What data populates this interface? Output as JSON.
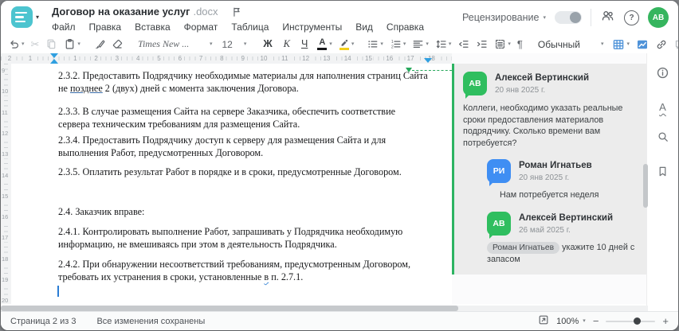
{
  "window": {
    "title": "Договор на оказание услуг",
    "title_ext": ".docx"
  },
  "menu": {
    "items": [
      "Файл",
      "Правка",
      "Вставка",
      "Формат",
      "Таблица",
      "Инструменты",
      "Вид",
      "Справка"
    ]
  },
  "header_right": {
    "review_label": "Рецензирование",
    "avatar_initials": "АВ"
  },
  "glyphs": {
    "caret": "▾",
    "pilcrow": "¶",
    "scissors": "✂",
    "more": "•••",
    "minus": "−",
    "plus": "+",
    "question": "?"
  },
  "toolbar": {
    "font_name": "Times New ...",
    "font_size": "12",
    "bold_label": "Ж",
    "italic_label": "К",
    "underline_label": "Ч",
    "font_color_label": "А",
    "style_name": "Обычный"
  },
  "ruler": {
    "h_left": [
      "2",
      "1"
    ],
    "h_main": [
      "1",
      "2",
      "3",
      "4",
      "5",
      "6",
      "7",
      "8",
      "9",
      "10",
      "11",
      "12",
      "13",
      "14",
      "15",
      "16",
      "17",
      "18"
    ],
    "v_numbers": [
      "9",
      "10",
      "11",
      "12",
      "13",
      "14",
      "15",
      "16",
      "17",
      "18",
      "19",
      "20"
    ]
  },
  "document": {
    "p1_before": "2.3.2. Предоставить Подрядчику необходимые материалы для наполнения страниц Сайта не ",
    "p1_underlined": "позднее",
    "p1_after": " 2 (двух) дней с момента заключения Договора.",
    "p2": "2.3.3. В случае размещения Сайта на сервере Заказчика, обеспечить соответствие сервера техническим требованиям для размещения Сайта.",
    "p3": "2.3.4. Предоставить Подрядчику доступ к серверу для размещения Сайта и для выполнения Работ, предусмотренных Договором.",
    "p4": "2.3.5. Оплатить результат Работ в порядке и в сроки, предусмотренные Договором.",
    "p5": "2.4. Заказчик вправе:",
    "p6": "2.4.1. Контролировать выполнение Работ, запрашивать у Подрядчика необходимую информацию, не вмешиваясь при этом в деятельность Подрядчика.",
    "p7_before": "2.4.2. При обнаружении несоответствий требованиям, предусмотренным Договором, требовать их устранения в сроки, установленные ",
    "p7_marked": "в",
    "p7_after": " п. 2.7.1."
  },
  "comments": {
    "c1": {
      "initials": "АВ",
      "name": "Алексей Вертинский",
      "date": "20 янв 2025 г.",
      "text": "Коллеги, необходимо указать реальные сроки предоставления материалов подрядчику. Сколько времени вам потребуется?"
    },
    "c2": {
      "initials": "РИ",
      "name": "Роман Игнатьев",
      "date": "20 янв 2025 г.",
      "text": "Нам потребуется неделя"
    },
    "c3": {
      "initials": "АВ",
      "name": "Алексей Вертинский",
      "date": "26 май 2025 г.",
      "mention": "Роман Игнатьев",
      "text": " укажите 10 дней с запасом"
    }
  },
  "statusbar": {
    "page_info": "Страница 2 из 3",
    "save_status": "Все изменения сохранены",
    "zoom_value": "100%"
  },
  "colors": {
    "logo": "#4cc4cf",
    "comment_green": "#2fbe5f",
    "reply_blue": "#3f8ef3",
    "indent_marker_blue": "#2f9fe0",
    "anchor_green": "#27a85c",
    "avatar_green": "#35b55e",
    "table_icon_blue": "#4f93d9",
    "highlight_yellow": "#f3cf1b"
  }
}
